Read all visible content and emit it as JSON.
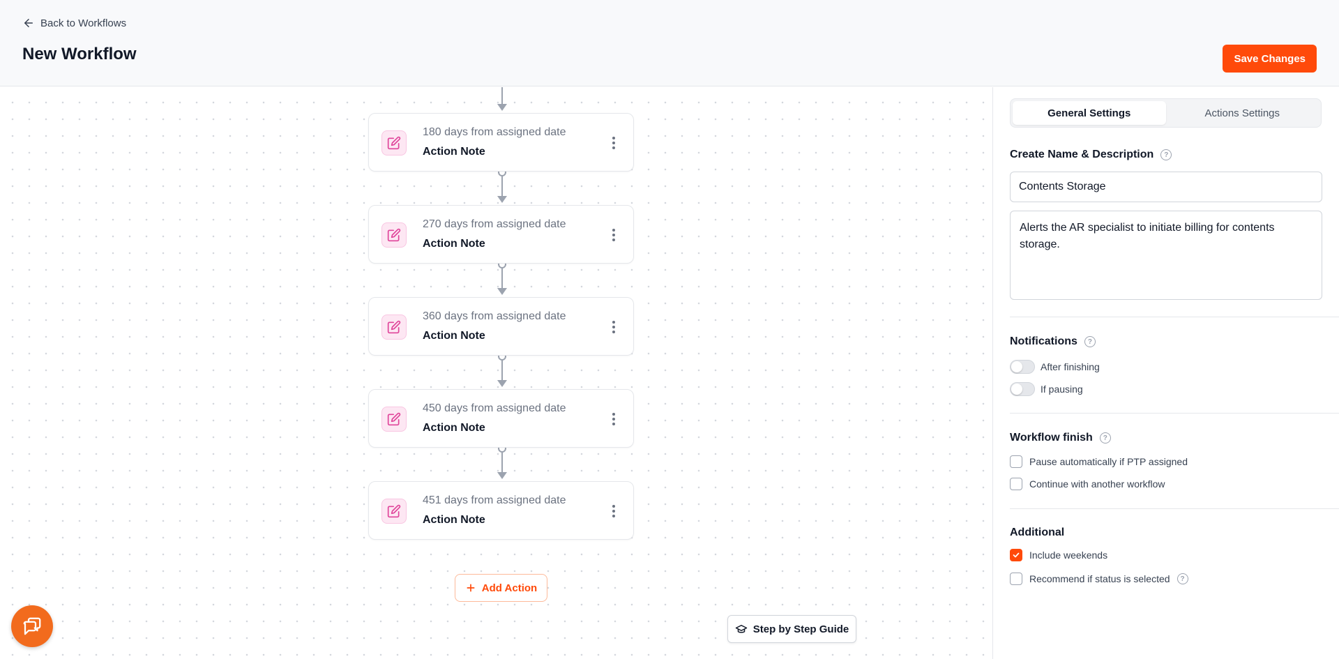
{
  "header": {
    "back_label": "Back to Workflows",
    "title": "New Workflow",
    "save_label": "Save Changes"
  },
  "actions": [
    {
      "delay": "180 days from assigned date",
      "type": "Action Note"
    },
    {
      "delay": "270 days from assigned date",
      "type": "Action Note"
    },
    {
      "delay": "360 days from assigned date",
      "type": "Action Note"
    },
    {
      "delay": "450 days from assigned date",
      "type": "Action Note"
    },
    {
      "delay": "451 days from assigned date",
      "type": "Action Note"
    }
  ],
  "canvas": {
    "add_action_label": "Add Action",
    "guide_label": "Step by Step Guide"
  },
  "panel": {
    "tabs": [
      {
        "label": "General Settings",
        "active": true
      },
      {
        "label": "Actions Settings",
        "active": false
      }
    ],
    "name_section": {
      "title": "Create Name & Description",
      "name_value": "Contents Storage",
      "description_value": "Alerts the AR specialist to initiate billing for contents storage."
    },
    "notifications": {
      "title": "Notifications",
      "items": [
        {
          "label": "After finishing",
          "on": false
        },
        {
          "label": "If pausing",
          "on": false
        }
      ]
    },
    "workflow_finish": {
      "title": "Workflow finish",
      "items": [
        {
          "label": "Pause automatically if PTP assigned",
          "checked": false
        },
        {
          "label": "Continue with another workflow",
          "checked": false
        }
      ]
    },
    "additional": {
      "title": "Additional",
      "items": [
        {
          "label": "Include weekends",
          "checked": true
        },
        {
          "label": "Recommend if status is selected",
          "checked": false
        }
      ]
    }
  },
  "colors": {
    "accent": "#ff4a0a",
    "action_icon": "#e0449a",
    "chat_fab": "#f26b1d"
  },
  "icons": {
    "back": "arrow-left-icon",
    "action": "edit-note-icon",
    "more": "more-vertical-icon",
    "add": "plus-icon",
    "guide": "graduation-cap-icon",
    "chat": "chat-bubbles-icon",
    "help": "help-circle-icon"
  }
}
